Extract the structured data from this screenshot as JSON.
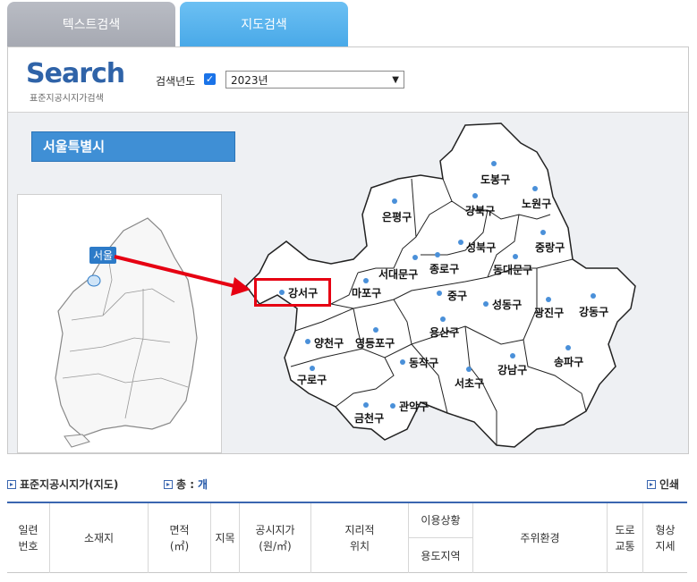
{
  "tabs": {
    "text_search": "텍스트검색",
    "map_search": "지도검색"
  },
  "search": {
    "logo": "Search",
    "logo_sub": "표준지공시지가검색",
    "year_label": "검색년도",
    "year_checked": true,
    "year_value": "2023년"
  },
  "region": {
    "title": "서울특별시",
    "mini_label": "서울"
  },
  "districts": {
    "dobong": "도봉구",
    "nowon": "노원구",
    "gangbuk": "강북구",
    "eunpyeong": "은평구",
    "seongbuk": "성북구",
    "jungnang": "중랑구",
    "jongno": "종로구",
    "seodaemun": "서대문구",
    "dongdaemun": "동대문구",
    "gangseo": "강서구",
    "mapo": "마포구",
    "jung": "중구",
    "seongdong": "성동구",
    "gwangjin": "광진구",
    "gangdong": "강동구",
    "yangcheon": "양천구",
    "yeongdeungpo": "영등포구",
    "yongsan": "용산구",
    "guro": "구로구",
    "dongjak": "동작구",
    "seocho": "서초구",
    "gangnam": "강남구",
    "songpa": "송파구",
    "geumcheon": "금천구",
    "gwanak": "관악구"
  },
  "list": {
    "title": "표준지공시지가(지도)",
    "total_label": "총 :",
    "total_unit": "개",
    "print": "인쇄"
  },
  "table_headers": {
    "serial_1": "일련",
    "serial_2": "번호",
    "location": "소재지",
    "area_1": "면적",
    "area_2": "(㎡)",
    "jimok": "지목",
    "price_1": "공시지가",
    "price_2": "(원/㎡)",
    "geo_1": "지리적",
    "geo_2": "위치",
    "usage": "이용상황",
    "zone": "용도지역",
    "surroundings": "주위환경",
    "road_1": "도로",
    "road_2": "교통",
    "shape_1": "형상",
    "shape_2": "지세"
  },
  "colors": {
    "accent": "#3f8fd5",
    "highlight": "#e60012",
    "arrow": "#e60012"
  }
}
